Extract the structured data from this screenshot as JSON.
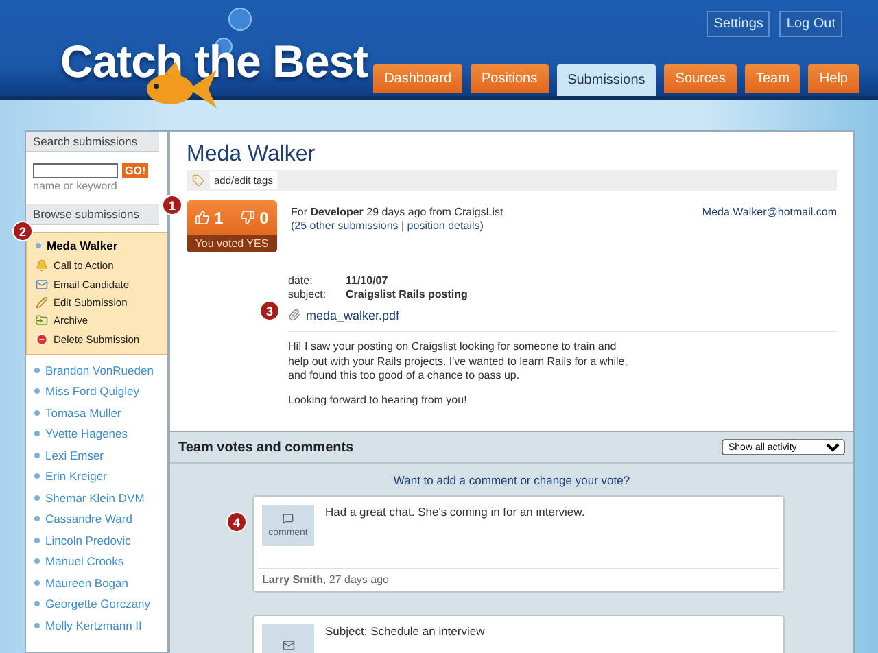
{
  "header": {
    "logo": "Catch the Best",
    "top_buttons": [
      "Settings",
      "Log Out"
    ],
    "tabs": [
      {
        "label": "Dashboard",
        "selected": false
      },
      {
        "label": "Positions",
        "selected": false
      },
      {
        "label": "Submissions",
        "selected": true
      },
      {
        "label": "Sources",
        "selected": false
      },
      {
        "label": "Team",
        "selected": false
      },
      {
        "label": "Help",
        "selected": false
      }
    ]
  },
  "sidebar": {
    "search_title": "Search submissions",
    "search_button": "GO!",
    "search_hint": "name or keyword",
    "browse_title": "Browse submissions",
    "current": {
      "name": "Meda Walker",
      "actions": [
        {
          "label": "Call to Action",
          "kind": "bell"
        },
        {
          "label": "Email Candidate",
          "kind": "email"
        },
        {
          "label": "Edit Submission",
          "kind": "edit"
        },
        {
          "label": "Archive",
          "kind": "archive"
        },
        {
          "label": "Delete Submission",
          "kind": "delete"
        }
      ]
    },
    "items": [
      "Brandon VonRueden",
      "Miss Ford Quigley",
      "Tomasa Muller",
      "Yvette Hagenes",
      "Lexi Emser",
      "Erin Kreiger",
      "Shemar Klein DVM",
      "Cassandre Ward",
      "Lincoln Predovic",
      "Manuel Crooks",
      "Maureen Bogan",
      "Georgette Gorczany",
      "Molly Kertzmann II"
    ]
  },
  "candidate": {
    "name": "Meda Walker",
    "tags_button": "add/edit tags",
    "votes": {
      "yes": "1",
      "no": "0",
      "status": "You voted YES"
    },
    "summary": "For **Developer** 29 days ago from CraigsList",
    "links": [
      {
        "text": "(",
        "kind": "plain"
      },
      {
        "text": "25 other submissions",
        "kind": "link"
      },
      {
        "text": " | ",
        "kind": "plain"
      },
      {
        "text": "position details",
        "kind": "link"
      },
      {
        "text": ")",
        "kind": "plain"
      }
    ],
    "email": "Meda.Walker@hotmail.com",
    "fields": [
      {
        "label": "date:",
        "value": "11/10/07"
      },
      {
        "label": "subject:",
        "value": "Craigslist Rails posting"
      }
    ],
    "attachment": "meda_walker.pdf",
    "body": [
      "Hi! I saw your posting on Craigslist looking for someone to train and help out with your Rails projects. I've wanted to learn Rails for a while, and found this too good of a chance to pass up.",
      "Looking forward to hearing from you!"
    ]
  },
  "comments": {
    "title": "Team votes and comments",
    "filter": "Show all activity",
    "prompt": "Want to add a comment or change your vote?",
    "entries": [
      {
        "kind": "comment",
        "icon_label": "comment",
        "text": "Had a great chat. She's coming in for an interview.",
        "author": "Larry Smith",
        "time": ", 27 days ago"
      },
      {
        "kind": "email",
        "text": "Subject: Schedule an interview"
      }
    ]
  },
  "callouts": [
    "1",
    "2",
    "3",
    "4"
  ]
}
